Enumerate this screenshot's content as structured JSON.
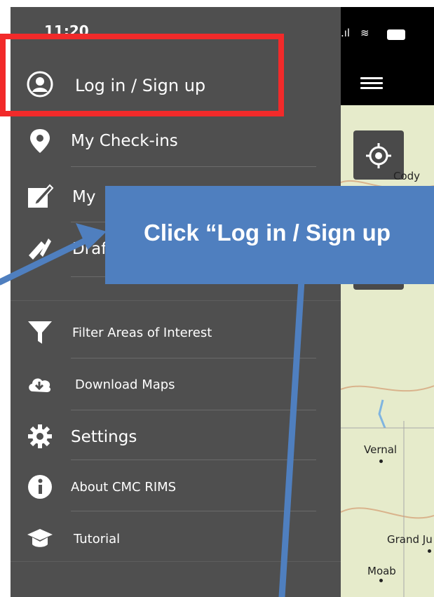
{
  "status_bar": {
    "time": "11:20"
  },
  "drawer": {
    "items": [
      {
        "label": "Log in / Sign up",
        "icon": "user-circle-icon"
      },
      {
        "label": "My Check-ins",
        "icon": "location-pin-icon"
      },
      {
        "label": "My",
        "icon": "edit-icon"
      },
      {
        "label": "Draf",
        "icon": "draft-tools-icon"
      },
      {
        "label": "Filter Areas of Interest",
        "icon": "filter-icon"
      },
      {
        "label": "Download Maps",
        "icon": "cloud-download-icon"
      },
      {
        "label": "Settings",
        "icon": "gear-icon"
      },
      {
        "label": "About CMC RIMS",
        "icon": "info-icon"
      },
      {
        "label": "Tutorial",
        "icon": "graduation-cap-icon"
      }
    ]
  },
  "map": {
    "labels": [
      "Cody",
      "Vernal",
      "Grand Ju",
      "Moab"
    ]
  },
  "annotation": {
    "callout_text": "Click “Log in / Sign up",
    "highlight_color": "#f22a2a",
    "callout_color": "#4f7fbf"
  }
}
